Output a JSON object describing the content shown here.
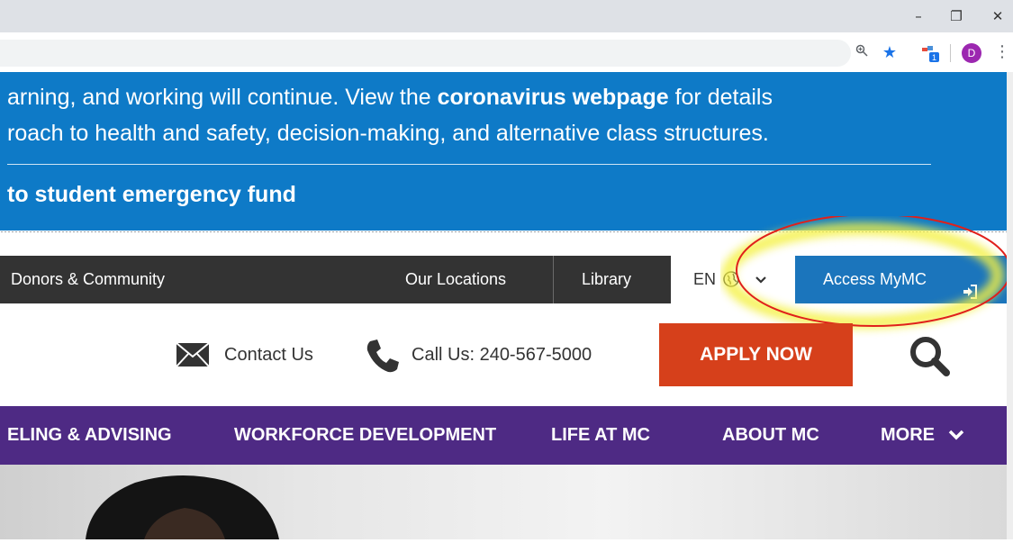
{
  "browser": {
    "window_controls": {
      "minimize": "–",
      "restore": "❐",
      "close": "✕"
    },
    "profile_initial": "D",
    "extension_badge": "1"
  },
  "alert": {
    "line1_prefix": "arning, and working will continue. View the ",
    "line1_bold": "coronavirus webpage",
    "line1_suffix": " for details",
    "line2": "roach to health and safety, decision-making, and alternative class structures.",
    "line3": "to student emergency fund"
  },
  "utility_nav": {
    "donors": "Donors & Community",
    "locations": "Our Locations",
    "library": "Library",
    "language": "EN",
    "access": "Access MyMC"
  },
  "contact": {
    "contact_label": "Contact Us",
    "call_label": "Call Us: 240-567-5000",
    "apply_label": "APPLY NOW"
  },
  "main_nav": {
    "items": [
      "ELING & ADVISING",
      "WORKFORCE DEVELOPMENT",
      "LIFE AT MC",
      "ABOUT MC",
      "MORE"
    ]
  },
  "colors": {
    "alert_blue": "#0e7ac7",
    "utility_dark": "#333333",
    "access_blue": "#1b75bc",
    "apply_orange": "#d6401b",
    "nav_purple": "#4e2a84",
    "highlight_red": "#e0201b"
  }
}
